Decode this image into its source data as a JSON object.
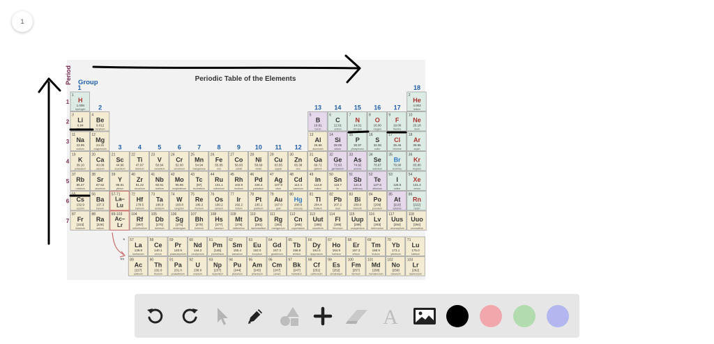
{
  "page": {
    "number": "1"
  },
  "periodic_table": {
    "title": "Periodic Table of the Elements",
    "axis_period": "Period",
    "axis_group": "Group",
    "group_numbers": [
      "1",
      "2",
      "3",
      "4",
      "5",
      "6",
      "7",
      "8",
      "9",
      "10",
      "11",
      "12",
      "13",
      "14",
      "15",
      "16",
      "17",
      "18"
    ],
    "period_numbers": [
      "1",
      "2",
      "3",
      "4",
      "5",
      "6",
      "7"
    ],
    "lanthanide_marker": "57-71",
    "actinide_marker": "89-103",
    "cells": [
      {
        "n": "1",
        "s": "H",
        "m": "1.008",
        "name": "hydrogen"
      },
      {
        "n": "2",
        "s": "He",
        "m": "4.003",
        "name": "helium"
      },
      {
        "n": "3",
        "s": "Li",
        "m": "6.94",
        "name": "lithium"
      },
      {
        "n": "4",
        "s": "Be",
        "m": "9.012",
        "name": "beryllium"
      },
      {
        "n": "5",
        "s": "B",
        "m": "10.81",
        "name": "boron"
      },
      {
        "n": "6",
        "s": "C",
        "m": "12.01",
        "name": "carbon"
      },
      {
        "n": "7",
        "s": "N",
        "m": "14.01",
        "name": "nitrogen"
      },
      {
        "n": "8",
        "s": "O",
        "m": "16.00",
        "name": "oxygen"
      },
      {
        "n": "9",
        "s": "F",
        "m": "19.00",
        "name": "fluorine"
      },
      {
        "n": "10",
        "s": "Ne",
        "m": "20.18",
        "name": "neon"
      },
      {
        "n": "11",
        "s": "Na",
        "m": "22.99",
        "name": "sodium"
      },
      {
        "n": "12",
        "s": "Mg",
        "m": "24.31",
        "name": "magnesium"
      },
      {
        "n": "13",
        "s": "Al",
        "m": "26.98",
        "name": "aluminum"
      },
      {
        "n": "14",
        "s": "Si",
        "m": "28.09",
        "name": "silicon"
      },
      {
        "n": "15",
        "s": "P",
        "m": "30.97",
        "name": "phosphorus"
      },
      {
        "n": "16",
        "s": "S",
        "m": "32.06",
        "name": "sulfur"
      },
      {
        "n": "17",
        "s": "Cl",
        "m": "35.45",
        "name": "chlorine"
      },
      {
        "n": "18",
        "s": "Ar",
        "m": "39.95",
        "name": "argon"
      },
      {
        "n": "19",
        "s": "K",
        "m": "39.10",
        "name": "potassium"
      },
      {
        "n": "20",
        "s": "Ca",
        "m": "40.08",
        "name": "calcium"
      },
      {
        "n": "21",
        "s": "Sc",
        "m": "44.96",
        "name": "scandium"
      },
      {
        "n": "22",
        "s": "Ti",
        "m": "47.87",
        "name": "titanium"
      },
      {
        "n": "23",
        "s": "V",
        "m": "50.94",
        "name": "vanadium"
      },
      {
        "n": "24",
        "s": "Cr",
        "m": "52.00",
        "name": "chromium"
      },
      {
        "n": "25",
        "s": "Mn",
        "m": "54.94",
        "name": "manganese"
      },
      {
        "n": "26",
        "s": "Fe",
        "m": "55.85",
        "name": "iron"
      },
      {
        "n": "27",
        "s": "Co",
        "m": "58.93",
        "name": "cobalt"
      },
      {
        "n": "28",
        "s": "Ni",
        "m": "58.69",
        "name": "nickel"
      },
      {
        "n": "29",
        "s": "Cu",
        "m": "63.55",
        "name": "copper"
      },
      {
        "n": "30",
        "s": "Zn",
        "m": "65.38",
        "name": "zinc"
      },
      {
        "n": "31",
        "s": "Ga",
        "m": "69.72",
        "name": "gallium"
      },
      {
        "n": "32",
        "s": "Ge",
        "m": "72.63",
        "name": "germanium"
      },
      {
        "n": "33",
        "s": "As",
        "m": "74.92",
        "name": "arsenic"
      },
      {
        "n": "34",
        "s": "Se",
        "m": "78.97",
        "name": "selenium"
      },
      {
        "n": "35",
        "s": "Br",
        "m": "79.90",
        "name": "bromine"
      },
      {
        "n": "36",
        "s": "Kr",
        "m": "83.80",
        "name": "krypton"
      },
      {
        "n": "37",
        "s": "Rb",
        "m": "85.47",
        "name": "rubidium"
      },
      {
        "n": "38",
        "s": "Sr",
        "m": "87.62",
        "name": "strontium"
      },
      {
        "n": "39",
        "s": "Y",
        "m": "88.91",
        "name": "yttrium"
      },
      {
        "n": "40",
        "s": "Zr",
        "m": "91.22",
        "name": "zirconium"
      },
      {
        "n": "41",
        "s": "Nb",
        "m": "92.91",
        "name": "niobium"
      },
      {
        "n": "42",
        "s": "Mo",
        "m": "95.95",
        "name": "molybdenum"
      },
      {
        "n": "43",
        "s": "Tc",
        "m": "[97]",
        "name": "technetium"
      },
      {
        "n": "44",
        "s": "Ru",
        "m": "101.1",
        "name": "ruthenium"
      },
      {
        "n": "45",
        "s": "Rh",
        "m": "102.9",
        "name": "rhodium"
      },
      {
        "n": "46",
        "s": "Pd",
        "m": "106.4",
        "name": "palladium"
      },
      {
        "n": "47",
        "s": "Ag",
        "m": "107.9",
        "name": "silver"
      },
      {
        "n": "48",
        "s": "Cd",
        "m": "112.4",
        "name": "cadmium"
      },
      {
        "n": "49",
        "s": "In",
        "m": "114.8",
        "name": "indium"
      },
      {
        "n": "50",
        "s": "Sn",
        "m": "118.7",
        "name": "tin"
      },
      {
        "n": "51",
        "s": "Sb",
        "m": "121.8",
        "name": "antimony"
      },
      {
        "n": "52",
        "s": "Te",
        "m": "127.6",
        "name": "tellurium"
      },
      {
        "n": "53",
        "s": "I",
        "m": "126.9",
        "name": "iodine"
      },
      {
        "n": "54",
        "s": "Xe",
        "m": "131.3",
        "name": "xenon"
      },
      {
        "n": "55",
        "s": "Cs",
        "m": "132.9",
        "name": "cesium"
      },
      {
        "n": "56",
        "s": "Ba",
        "m": "137.3",
        "name": "barium"
      },
      {
        "n": "57-71",
        "s": "La–Lu",
        "m": "",
        "name": ""
      },
      {
        "n": "72",
        "s": "Hf",
        "m": "178.5",
        "name": "hafnium"
      },
      {
        "n": "73",
        "s": "Ta",
        "m": "180.9",
        "name": "tantalum"
      },
      {
        "n": "74",
        "s": "W",
        "m": "183.8",
        "name": "tungsten"
      },
      {
        "n": "75",
        "s": "Re",
        "m": "186.2",
        "name": "rhenium"
      },
      {
        "n": "76",
        "s": "Os",
        "m": "190.2",
        "name": "osmium"
      },
      {
        "n": "77",
        "s": "Ir",
        "m": "192.2",
        "name": "iridium"
      },
      {
        "n": "78",
        "s": "Pt",
        "m": "195.1",
        "name": "platinum"
      },
      {
        "n": "79",
        "s": "Au",
        "m": "197.0",
        "name": "gold"
      },
      {
        "n": "80",
        "s": "Hg",
        "m": "200.6",
        "name": "mercury"
      },
      {
        "n": "81",
        "s": "Tl",
        "m": "204.4",
        "name": "thallium"
      },
      {
        "n": "82",
        "s": "Pb",
        "m": "207.2",
        "name": "lead"
      },
      {
        "n": "83",
        "s": "Bi",
        "m": "209.0",
        "name": "bismuth"
      },
      {
        "n": "84",
        "s": "Po",
        "m": "[209]",
        "name": "polonium"
      },
      {
        "n": "85",
        "s": "At",
        "m": "[210]",
        "name": "astatine"
      },
      {
        "n": "86",
        "s": "Rn",
        "m": "[222]",
        "name": "radon"
      },
      {
        "n": "87",
        "s": "Fr",
        "m": "[223]",
        "name": "francium"
      },
      {
        "n": "88",
        "s": "Ra",
        "m": "[226]",
        "name": "radium"
      },
      {
        "n": "89-103",
        "s": "Ac–Lr",
        "m": "",
        "name": ""
      },
      {
        "n": "104",
        "s": "Rf",
        "m": "[267]",
        "name": "rutherfordium"
      },
      {
        "n": "105",
        "s": "Db",
        "m": "[270]",
        "name": "dubnium"
      },
      {
        "n": "106",
        "s": "Sg",
        "m": "[271]",
        "name": "seaborgium"
      },
      {
        "n": "107",
        "s": "Bh",
        "m": "[270]",
        "name": "bohrium"
      },
      {
        "n": "108",
        "s": "Hs",
        "m": "[277]",
        "name": "hassium"
      },
      {
        "n": "109",
        "s": "Mt",
        "m": "[276]",
        "name": "meitnerium"
      },
      {
        "n": "110",
        "s": "Ds",
        "m": "[281]",
        "name": "darmstadtium"
      },
      {
        "n": "111",
        "s": "Rg",
        "m": "[282]",
        "name": "roentgenium"
      },
      {
        "n": "112",
        "s": "Cn",
        "m": "[285]",
        "name": "copernicium"
      },
      {
        "n": "113",
        "s": "Uut",
        "m": "[285]",
        "name": "ununtrium"
      },
      {
        "n": "114",
        "s": "Fl",
        "m": "[289]",
        "name": "flerovium"
      },
      {
        "n": "115",
        "s": "Uup",
        "m": "[288]",
        "name": "ununpentium"
      },
      {
        "n": "116",
        "s": "Lv",
        "m": "[293]",
        "name": "livermorium"
      },
      {
        "n": "117",
        "s": "Uus",
        "m": "[294]",
        "name": "ununseptium"
      },
      {
        "n": "118",
        "s": "Uuo",
        "m": "[294]",
        "name": "ununoctium"
      },
      {
        "n": "57",
        "s": "La",
        "m": "138.9",
        "name": "lanthanum"
      },
      {
        "n": "58",
        "s": "Ce",
        "m": "140.1",
        "name": "cerium"
      },
      {
        "n": "59",
        "s": "Pr",
        "m": "140.9",
        "name": "praseodymium"
      },
      {
        "n": "60",
        "s": "Nd",
        "m": "144.2",
        "name": "neodymium"
      },
      {
        "n": "61",
        "s": "Pm",
        "m": "[145]",
        "name": "promethium"
      },
      {
        "n": "62",
        "s": "Sm",
        "m": "150.4",
        "name": "samarium"
      },
      {
        "n": "63",
        "s": "Eu",
        "m": "152.0",
        "name": "europium"
      },
      {
        "n": "64",
        "s": "Gd",
        "m": "157.3",
        "name": "gadolinium"
      },
      {
        "n": "65",
        "s": "Tb",
        "m": "158.9",
        "name": "terbium"
      },
      {
        "n": "66",
        "s": "Dy",
        "m": "162.5",
        "name": "dysprosium"
      },
      {
        "n": "67",
        "s": "Ho",
        "m": "164.9",
        "name": "holmium"
      },
      {
        "n": "68",
        "s": "Er",
        "m": "167.3",
        "name": "erbium"
      },
      {
        "n": "69",
        "s": "Tm",
        "m": "168.9",
        "name": "thulium"
      },
      {
        "n": "70",
        "s": "Yb",
        "m": "173.1",
        "name": "ytterbium"
      },
      {
        "n": "71",
        "s": "Lu",
        "m": "175.0",
        "name": "lutetium"
      },
      {
        "n": "89",
        "s": "Ac",
        "m": "[227]",
        "name": "actinium"
      },
      {
        "n": "90",
        "s": "Th",
        "m": "232.0",
        "name": "thorium"
      },
      {
        "n": "91",
        "s": "Pa",
        "m": "231.0",
        "name": "protactinium"
      },
      {
        "n": "92",
        "s": "U",
        "m": "238.0",
        "name": "uranium"
      },
      {
        "n": "93",
        "s": "Np",
        "m": "[237]",
        "name": "neptunium"
      },
      {
        "n": "94",
        "s": "Pu",
        "m": "[244]",
        "name": "plutonium"
      },
      {
        "n": "95",
        "s": "Am",
        "m": "[243]",
        "name": "americium"
      },
      {
        "n": "96",
        "s": "Cm",
        "m": "[247]",
        "name": "curium"
      },
      {
        "n": "97",
        "s": "Bk",
        "m": "[247]",
        "name": "berkelium"
      },
      {
        "n": "98",
        "s": "Cf",
        "m": "[251]",
        "name": "californium"
      },
      {
        "n": "99",
        "s": "Es",
        "m": "[252]",
        "name": "einsteinium"
      },
      {
        "n": "100",
        "s": "Fm",
        "m": "[257]",
        "name": "fermium"
      },
      {
        "n": "101",
        "s": "Md",
        "m": "[258]",
        "name": "mendelevium"
      },
      {
        "n": "102",
        "s": "No",
        "m": "[259]",
        "name": "nobelium"
      },
      {
        "n": "103",
        "s": "Lr",
        "m": "[262]",
        "name": "lawrencium"
      }
    ]
  },
  "toolbar": {
    "tools": [
      {
        "name": "undo",
        "icon": "undo-icon"
      },
      {
        "name": "redo",
        "icon": "redo-icon"
      },
      {
        "name": "select",
        "icon": "pointer-icon"
      },
      {
        "name": "pen",
        "icon": "pencil-icon"
      },
      {
        "name": "shapes",
        "icon": "shapes-icon"
      },
      {
        "name": "add",
        "icon": "plus-icon"
      },
      {
        "name": "eraser",
        "icon": "eraser-icon"
      },
      {
        "name": "text",
        "icon": "text-icon"
      },
      {
        "name": "image",
        "icon": "image-icon"
      }
    ],
    "colors": [
      "#000000",
      "#f2a7ad",
      "#b3dbb0",
      "#b3b6ef"
    ]
  },
  "colors": {
    "cell_metal": "#f4ecd2",
    "cell_metalloid": "#e4d8ea",
    "cell_nonmetal": "#dcebe3",
    "symbol": "#333333",
    "symbol_red": "#a8332f",
    "symbol_blue": "#2f78c2",
    "period_label": "#7a2b52",
    "group_label": "#1f5fa8",
    "arrow_color": "#3a3a3a"
  }
}
